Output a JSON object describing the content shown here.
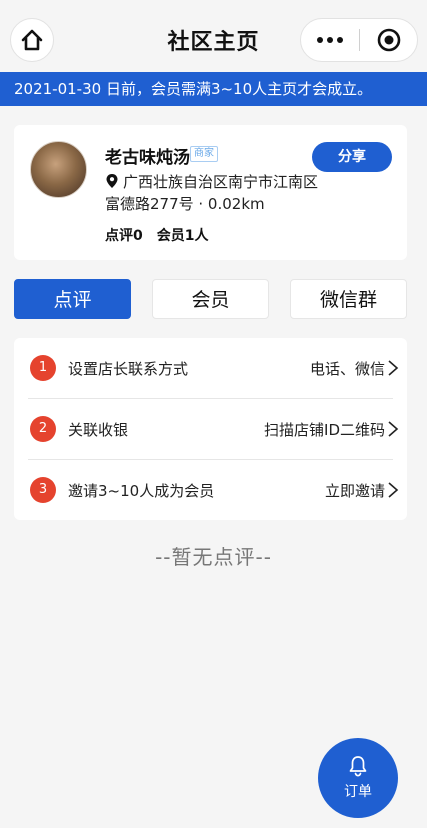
{
  "nav": {
    "title": "社区主页",
    "home_icon": "home-icon",
    "more_icon": "more-icon",
    "close_icon": "target-icon"
  },
  "notice": {
    "text": "2021-01-30 日前，会员需满3~10人主页才会成立。",
    "bg_color": "#1f5fd1"
  },
  "shop": {
    "name": "老古味炖汤",
    "tag": "商家",
    "share_label": "分享",
    "address": "广西壮族自治区南宁市江南区富德路277号 · 0.02km",
    "reviews_label": "点评0",
    "members_label": "会员1人"
  },
  "tabs": [
    {
      "label": "点评",
      "active": true
    },
    {
      "label": "会员",
      "active": false
    },
    {
      "label": "微信群",
      "active": false
    }
  ],
  "steps": [
    {
      "num": "1",
      "label": "设置店长联系方式",
      "action": "电话、微信"
    },
    {
      "num": "2",
      "label": "关联收银",
      "action": "扫描店铺ID二维码"
    },
    {
      "num": "3",
      "label": "邀请3~10人成为会员",
      "action": "立即邀请"
    }
  ],
  "empty_text": "--暂无点评--",
  "fab": {
    "label": "订单",
    "icon": "bell-icon"
  },
  "colors": {
    "accent": "#1f5fd1",
    "step_badge": "#e5432e"
  }
}
